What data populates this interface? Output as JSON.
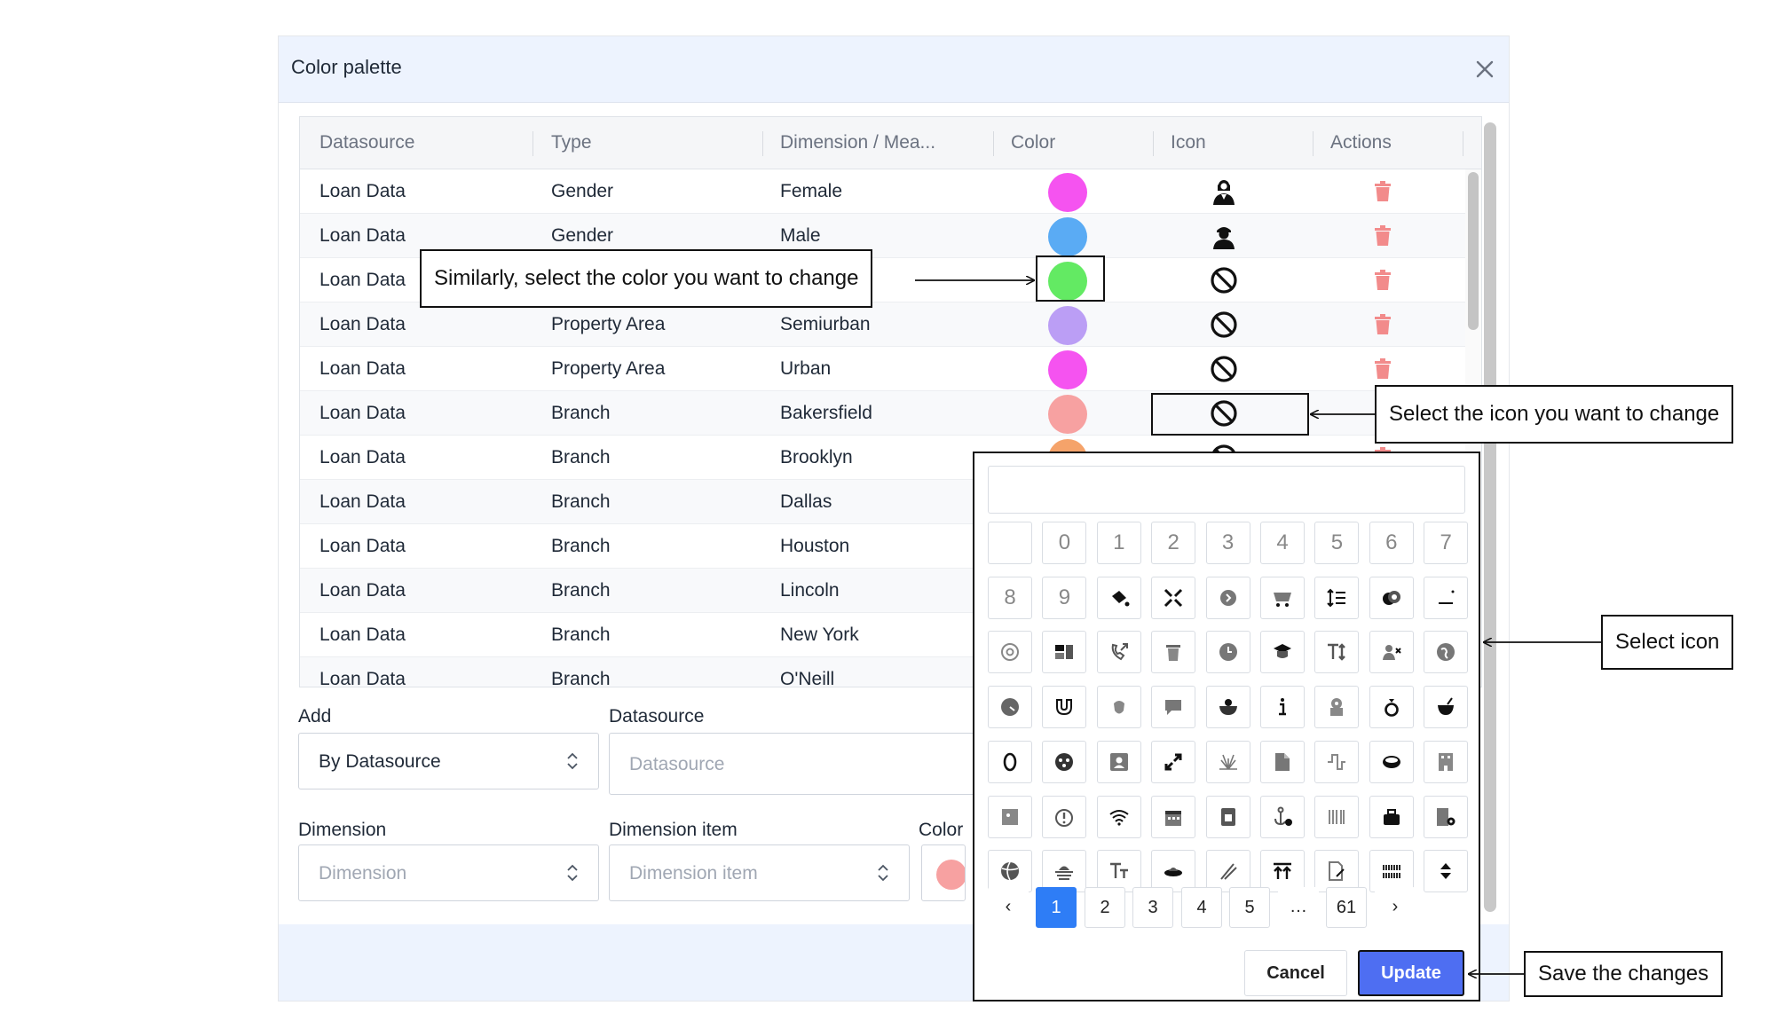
{
  "modal": {
    "title": "Color palette"
  },
  "table": {
    "headers": [
      "Datasource",
      "Type",
      "Dimension / Mea...",
      "Color",
      "Icon",
      "Actions"
    ],
    "rows": [
      {
        "datasource": "Loan Data",
        "type": "Gender",
        "dimension": "Female",
        "color": "#f553f0",
        "icon": "female-icon"
      },
      {
        "datasource": "Loan Data",
        "type": "Gender",
        "dimension": "Male",
        "color": "#5aabf4",
        "icon": "male-icon"
      },
      {
        "datasource": "Loan Data",
        "type": "",
        "dimension": "",
        "color": "#63ea63",
        "icon": "no-icon"
      },
      {
        "datasource": "Loan Data",
        "type": "Property Area",
        "dimension": "Semiurban",
        "color": "#bb9ef5",
        "icon": "no-icon"
      },
      {
        "datasource": "Loan Data",
        "type": "Property Area",
        "dimension": "Urban",
        "color": "#f553f0",
        "icon": "no-icon"
      },
      {
        "datasource": "Loan Data",
        "type": "Branch",
        "dimension": "Bakersfield",
        "color": "#f7a1a1",
        "icon": "no-icon"
      },
      {
        "datasource": "Loan Data",
        "type": "Branch",
        "dimension": "Brooklyn",
        "color": "#f5a36a",
        "icon": "no-icon"
      },
      {
        "datasource": "Loan Data",
        "type": "Branch",
        "dimension": "Dallas",
        "color": "",
        "icon": ""
      },
      {
        "datasource": "Loan Data",
        "type": "Branch",
        "dimension": "Houston",
        "color": "",
        "icon": ""
      },
      {
        "datasource": "Loan Data",
        "type": "Branch",
        "dimension": "Lincoln",
        "color": "",
        "icon": ""
      },
      {
        "datasource": "Loan Data",
        "type": "Branch",
        "dimension": "New York",
        "color": "",
        "icon": ""
      },
      {
        "datasource": "Loan Data",
        "type": "Branch",
        "dimension": "O'Neill",
        "color": "",
        "icon": ""
      }
    ]
  },
  "form": {
    "add_label": "Add",
    "add_value": "By Datasource",
    "datasource_label": "Datasource",
    "datasource_placeholder": "Datasource",
    "dimension_label": "Dimension",
    "dimension_placeholder": "Dimension",
    "dimension_item_label": "Dimension item",
    "dimension_item_placeholder": "Dimension item",
    "color_label": "Color",
    "color_value": "#f7a1a1"
  },
  "picker": {
    "search_value": "",
    "digits_row1": [
      "",
      "0",
      "1",
      "2",
      "3",
      "4",
      "5",
      "6",
      "7"
    ],
    "digits_row2": [
      "8",
      "9"
    ],
    "icons": [
      "paint-bucket-icon",
      "compress-arrows-icon",
      "circle-chevron-icon",
      "mining-cart-icon",
      "line-height-icon",
      "coins-icon",
      "underscore-icon",
      "at-sign-icon",
      "toggle-icon",
      "phone-arrow-icon",
      "trash-icon",
      "clock-icon",
      "mortarboard-icon",
      "text-height-icon",
      "user-remove-icon",
      "globe-icon",
      "dial-icon",
      "magnet-icon",
      "acorn-icon",
      "comment-icon",
      "bowl-icon",
      "info-icon",
      "robot-icon",
      "ring-icon",
      "cauldron-icon",
      "zero-icon",
      "dice-face-icon",
      "portrait-icon",
      "expand-arrows-icon",
      "burst-icon",
      "document-icon",
      "square-wave-icon",
      "oval-icon",
      "building-icon",
      "square-dot-icon",
      "alert-bell-icon",
      "wifi-icon",
      "calendar-icon",
      "sim-card-icon",
      "anchor-check-icon",
      "barcode-icon",
      "toolbox-icon",
      "building-gear-icon",
      "volleyball-icon",
      "sunset-icon",
      "text-size-icon",
      "ufo-icon",
      "chopsticks-icon",
      "arrows-up-icon",
      "file-signature-icon",
      "barcode-grid-icon",
      "sort-icon"
    ],
    "pages": [
      "‹",
      "1",
      "2",
      "3",
      "4",
      "5",
      "…",
      "61",
      "›"
    ],
    "active_page": "1",
    "cancel_label": "Cancel",
    "update_label": "Update"
  },
  "annotations": {
    "color_note": "Similarly, select the color you want to change",
    "icon_note": "Select the icon you want to change",
    "select_icon_note": "Select icon",
    "save_note": "Save the changes"
  }
}
